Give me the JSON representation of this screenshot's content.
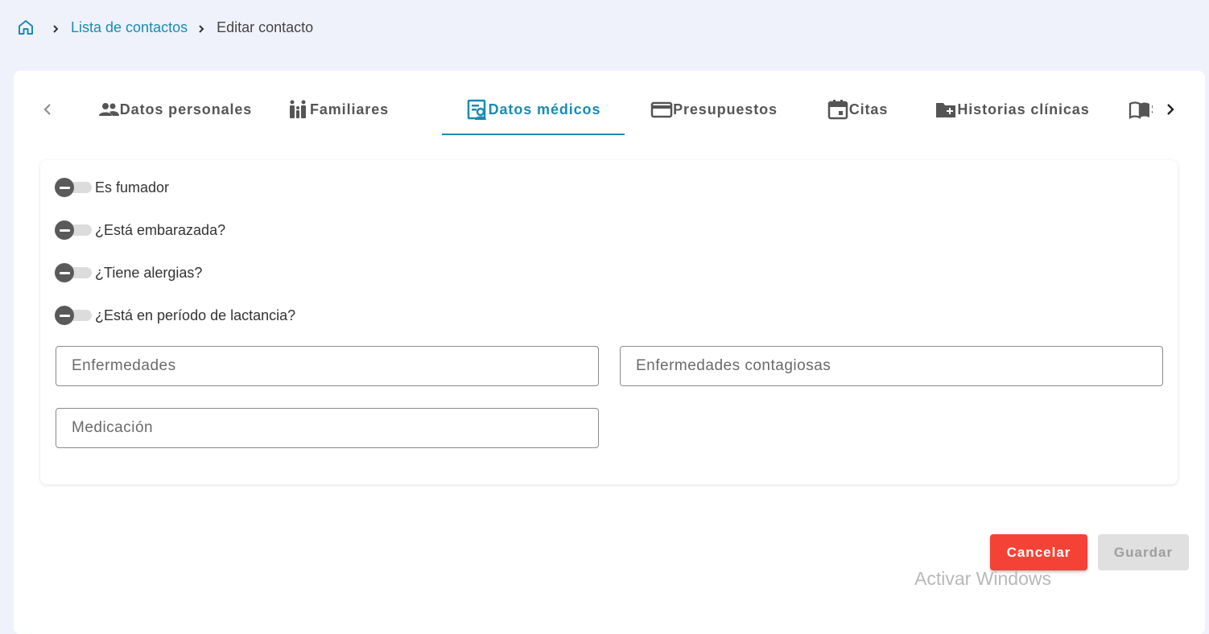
{
  "breadcrumb": {
    "home_icon": "home-icon",
    "link": "Lista de contactos",
    "current": "Editar contacto"
  },
  "tabs": [
    {
      "label": "Datos personales",
      "icon": "people-icon",
      "active": false
    },
    {
      "label": "Familiares",
      "icon": "family-icon",
      "active": false
    },
    {
      "label": "Datos médicos",
      "icon": "medical-record-icon",
      "active": true
    },
    {
      "label": "Presupuestos",
      "icon": "credit-card-icon",
      "active": false
    },
    {
      "label": "Citas",
      "icon": "calendar-icon",
      "active": false
    },
    {
      "label": "Historias clínicas",
      "icon": "folder-add-icon",
      "active": false
    },
    {
      "label": "Se",
      "icon": "book-icon",
      "active": false
    }
  ],
  "toggles": [
    {
      "label": "Es fumador",
      "state": "indeterminate"
    },
    {
      "label": "¿Está embarazada?",
      "state": "indeterminate"
    },
    {
      "label": "¿Tiene alergias?",
      "state": "indeterminate"
    },
    {
      "label": "¿Está en período de lactancia?",
      "state": "indeterminate"
    }
  ],
  "fields": {
    "enfermedades": {
      "placeholder": "Enfermedades",
      "value": ""
    },
    "enfermedades_contagiosas": {
      "placeholder": "Enfermedades contagiosas",
      "value": ""
    },
    "medicacion": {
      "placeholder": "Medicación",
      "value": ""
    }
  },
  "actions": {
    "cancel_label": "Cancelar",
    "save_label": "Guardar",
    "cancel_color": "#f44336",
    "save_color": "#e0e0e0"
  },
  "colors": {
    "accent": "#1a8bb2",
    "background": "#f0f2fb"
  },
  "watermark": "Activar Windows"
}
